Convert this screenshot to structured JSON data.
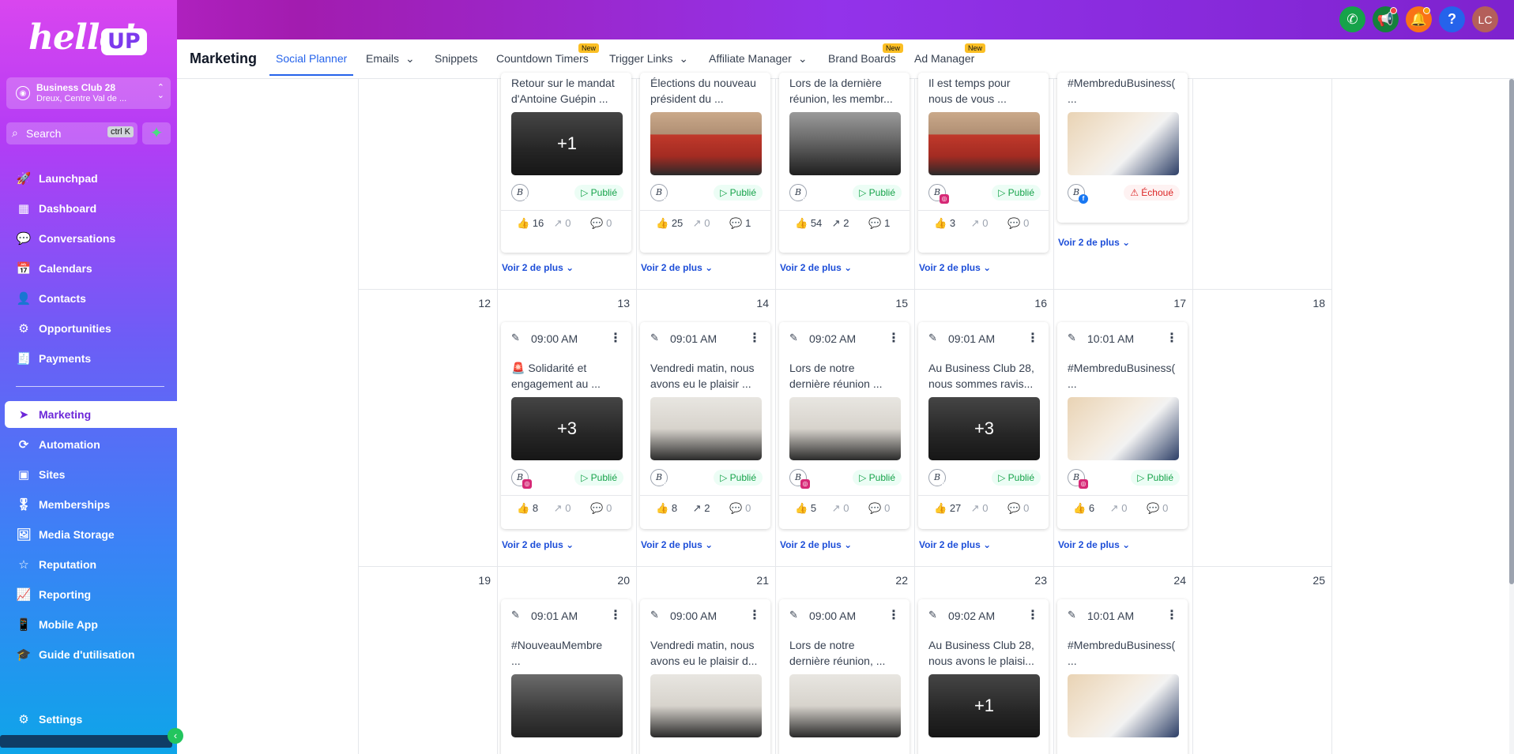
{
  "brand": {
    "logo_text": "hello!",
    "logo_badge": "UP"
  },
  "account": {
    "name": "Business Club 28",
    "location": "Dreux, Centre Val de ..."
  },
  "search": {
    "label": "Search",
    "shortcut": "ctrl K"
  },
  "sidebar": {
    "items": [
      {
        "label": "Launchpad",
        "icon": "rocket-icon",
        "glyph": "🚀"
      },
      {
        "label": "Dashboard",
        "icon": "grid-icon",
        "glyph": "▦"
      },
      {
        "label": "Conversations",
        "icon": "chat-icon",
        "glyph": "💬"
      },
      {
        "label": "Calendars",
        "icon": "calendar-icon",
        "glyph": "📅"
      },
      {
        "label": "Contacts",
        "icon": "contacts-icon",
        "glyph": "👤"
      },
      {
        "label": "Opportunities",
        "icon": "opportunities-icon",
        "glyph": "⚙"
      },
      {
        "label": "Payments",
        "icon": "payments-icon",
        "glyph": "🧾"
      },
      {
        "label": "Marketing",
        "icon": "send-icon",
        "glyph": "➤"
      },
      {
        "label": "Automation",
        "icon": "automation-icon",
        "glyph": "⟳"
      },
      {
        "label": "Sites",
        "icon": "sites-icon",
        "glyph": "▣"
      },
      {
        "label": "Memberships",
        "icon": "memberships-icon",
        "glyph": "🎖"
      },
      {
        "label": "Media Storage",
        "icon": "media-icon",
        "glyph": "🖼"
      },
      {
        "label": "Reputation",
        "icon": "star-icon",
        "glyph": "☆"
      },
      {
        "label": "Reporting",
        "icon": "reporting-icon",
        "glyph": "📈"
      },
      {
        "label": "Mobile App",
        "icon": "mobile-icon",
        "glyph": "📱"
      },
      {
        "label": "Guide d'utilisation",
        "icon": "graduation-icon",
        "glyph": "🎓"
      },
      {
        "label": "Settings",
        "icon": "gear-icon",
        "glyph": "⚙"
      }
    ]
  },
  "subnav": {
    "title": "Marketing",
    "tabs": [
      {
        "label": "Social Planner",
        "chevron": "",
        "badge": ""
      },
      {
        "label": "Emails",
        "chevron": "⌄",
        "badge": ""
      },
      {
        "label": "Snippets",
        "chevron": "",
        "badge": ""
      },
      {
        "label": "Countdown Timers",
        "chevron": "",
        "badge": "New"
      },
      {
        "label": "Trigger Links",
        "chevron": "⌄",
        "badge": ""
      },
      {
        "label": "Affiliate Manager",
        "chevron": "⌄",
        "badge": ""
      },
      {
        "label": "Brand Boards",
        "chevron": "",
        "badge": "New"
      },
      {
        "label": "Ad Manager",
        "chevron": "",
        "badge": "New"
      }
    ]
  },
  "topbar": {
    "help": "?",
    "avatar_initials": "LC"
  },
  "calendar": {
    "voir_plus": "Voir 2 de plus",
    "avatar_letter": "B",
    "weeks": [
      {
        "days": [
          "",
          "",
          "",
          "",
          "",
          "",
          ""
        ]
      },
      {
        "days": [
          "12",
          "13",
          "14",
          "15",
          "16",
          "17",
          "18"
        ]
      },
      {
        "days": [
          "19",
          "20",
          "21",
          "22",
          "23",
          "24",
          "25"
        ]
      }
    ],
    "cards_week1": [
      {
        "text1": "Retour sur le mandat",
        "text2": "d'Antoine Guépin ...",
        "overlay": "+1",
        "network": "in",
        "status": "Publié",
        "likes": "16",
        "shares": "0",
        "comments": "0",
        "img": "dark"
      },
      {
        "text1": "Élections du nouveau",
        "text2": "président du ...",
        "overlay": "",
        "network": "in",
        "status": "Publié",
        "likes": "25",
        "shares": "0",
        "comments": "1",
        "img": "red"
      },
      {
        "text1": "Lors de la dernière",
        "text2": "réunion, les membr...",
        "overlay": "",
        "network": "in",
        "status": "Publié",
        "likes": "54",
        "shares": "2",
        "comments": "1",
        "img": "group"
      },
      {
        "text1": "Il est temps pour",
        "text2": "nous de vous ...",
        "overlay": "",
        "network": "ig",
        "status": "Publié",
        "likes": "3",
        "shares": "0",
        "comments": "0",
        "img": "red"
      },
      {
        "text1": "#MembreduBusiness(",
        "text2": "...",
        "overlay": "",
        "network": "fb",
        "status": "Échoué",
        "likes": "",
        "shares": "",
        "comments": "",
        "img": "beige"
      }
    ],
    "cards_week2": [
      {
        "time": "09:00 AM",
        "text1": "🚨 Solidarité et",
        "text2": "engagement au ...",
        "overlay": "+3",
        "network": "ig",
        "status": "Publié",
        "likes": "8",
        "shares": "0",
        "comments": "0",
        "img": "dark"
      },
      {
        "time": "09:01 AM",
        "text1": "Vendredi matin, nous",
        "text2": "avons eu le plaisir ...",
        "overlay": "",
        "network": "in",
        "status": "Publié",
        "likes": "8",
        "shares": "2",
        "comments": "0",
        "img": "light"
      },
      {
        "time": "09:02 AM",
        "text1": "Lors de notre",
        "text2": "dernière réunion ...",
        "overlay": "",
        "network": "ig",
        "status": "Publié",
        "likes": "5",
        "shares": "0",
        "comments": "0",
        "img": "light"
      },
      {
        "time": "09:01 AM",
        "text1": "Au Business Club 28,",
        "text2": "nous sommes ravis...",
        "overlay": "+3",
        "network": "in",
        "status": "Publié",
        "likes": "27",
        "shares": "0",
        "comments": "0",
        "img": "dark"
      },
      {
        "time": "10:01 AM",
        "text1": "#MembreduBusiness(",
        "text2": "...",
        "overlay": "",
        "network": "ig",
        "status": "Publié",
        "likes": "6",
        "shares": "0",
        "comments": "0",
        "img": "beige"
      }
    ],
    "cards_week3": [
      {
        "time": "09:01 AM",
        "text1": "#NouveauMembre",
        "text2": "...",
        "overlay": "",
        "img": "dark"
      },
      {
        "time": "09:00 AM",
        "text1": "Vendredi matin, nous",
        "text2": "avons eu le plaisir d...",
        "overlay": "",
        "img": "light"
      },
      {
        "time": "09:00 AM",
        "text1": "Lors de notre",
        "text2": "dernière réunion, ...",
        "overlay": "",
        "img": "light"
      },
      {
        "time": "09:02 AM",
        "text1": "Au Business Club 28,",
        "text2": "nous avons le plaisi...",
        "overlay": "+1",
        "img": "dark"
      },
      {
        "time": "10:01 AM",
        "text1": "#MembreduBusiness(",
        "text2": "...",
        "overlay": "",
        "img": "beige"
      }
    ]
  },
  "colors": {
    "accent": "#2563eb",
    "published": "#16a34a",
    "failed": "#dc2626",
    "new_badge": "#fbbf24"
  }
}
